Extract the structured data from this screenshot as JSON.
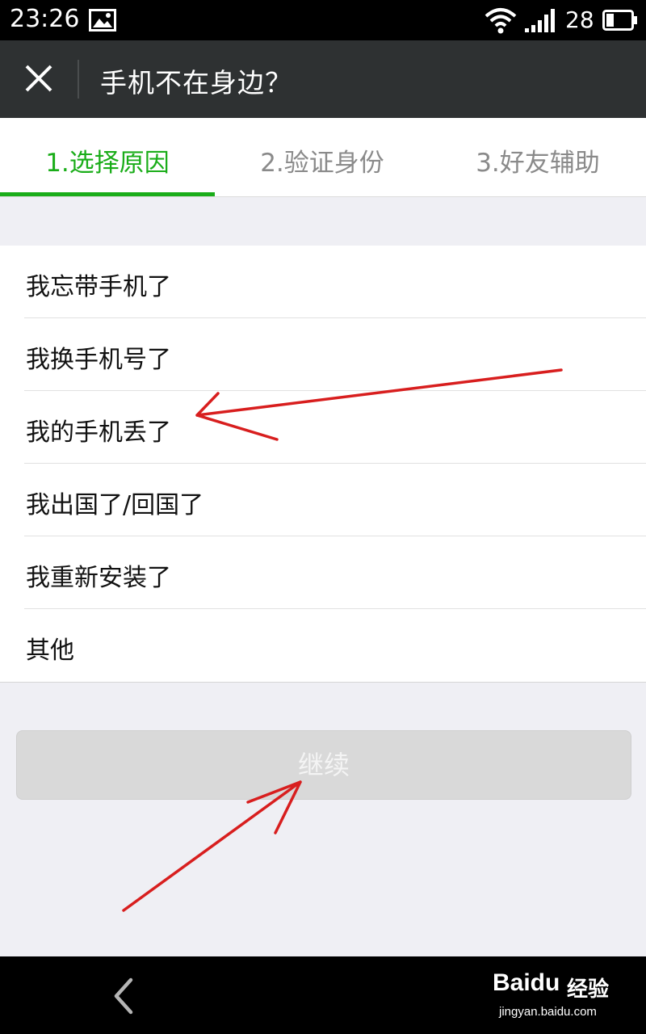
{
  "status_bar": {
    "time": "23:26",
    "battery_level": "28"
  },
  "title_bar": {
    "title": "手机不在身边？"
  },
  "tabs": [
    {
      "label": "1.选择原因",
      "active": true
    },
    {
      "label": "2.验证身份",
      "active": false
    },
    {
      "label": "3.好友辅助",
      "active": false
    }
  ],
  "reasons": [
    {
      "label": "我忘带手机了"
    },
    {
      "label": "我换手机号了"
    },
    {
      "label": "我的手机丢了"
    },
    {
      "label": "我出国了/回国了"
    },
    {
      "label": "我重新安装了"
    },
    {
      "label": "其他"
    }
  ],
  "continue_button": {
    "label": "继续",
    "enabled": false
  },
  "watermark": {
    "brand": "Baidu",
    "product": "经验",
    "url": "jingyan.baidu.com"
  },
  "colors": {
    "accent": "#1aad19",
    "title_bar_bg": "#2e3132",
    "annotation_arrow": "#d81e1e"
  }
}
